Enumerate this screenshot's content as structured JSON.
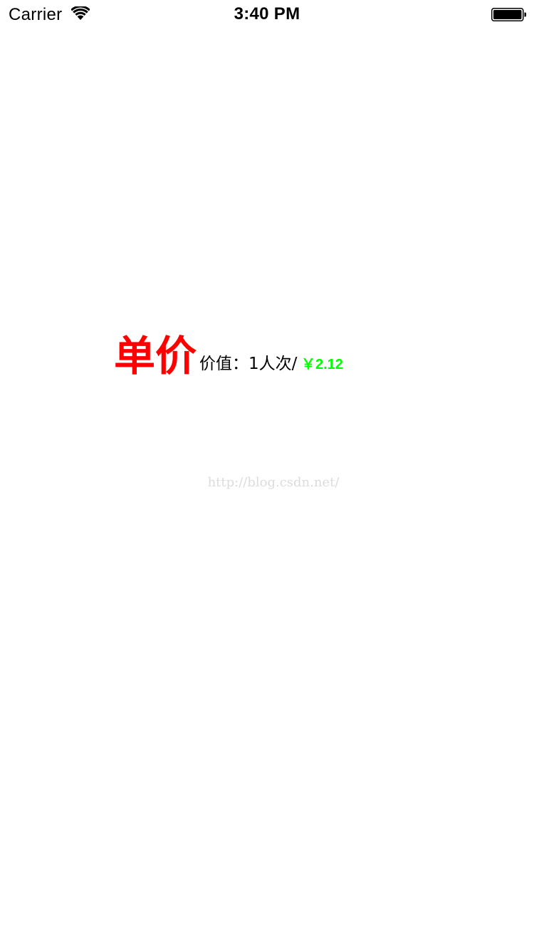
{
  "status_bar": {
    "carrier": "Carrier",
    "time": "3:40 PM",
    "wifi_icon": "wifi-icon",
    "battery_icon": "battery-full-icon"
  },
  "price_row": {
    "title": "单价",
    "value_label": "价值：1人次/",
    "price": "￥2.12"
  },
  "watermark": "http://blog.csdn.net/",
  "colors": {
    "title": "#ff0000",
    "price": "#00ff00",
    "text": "#000000",
    "watermark": "#dcdcdc"
  }
}
